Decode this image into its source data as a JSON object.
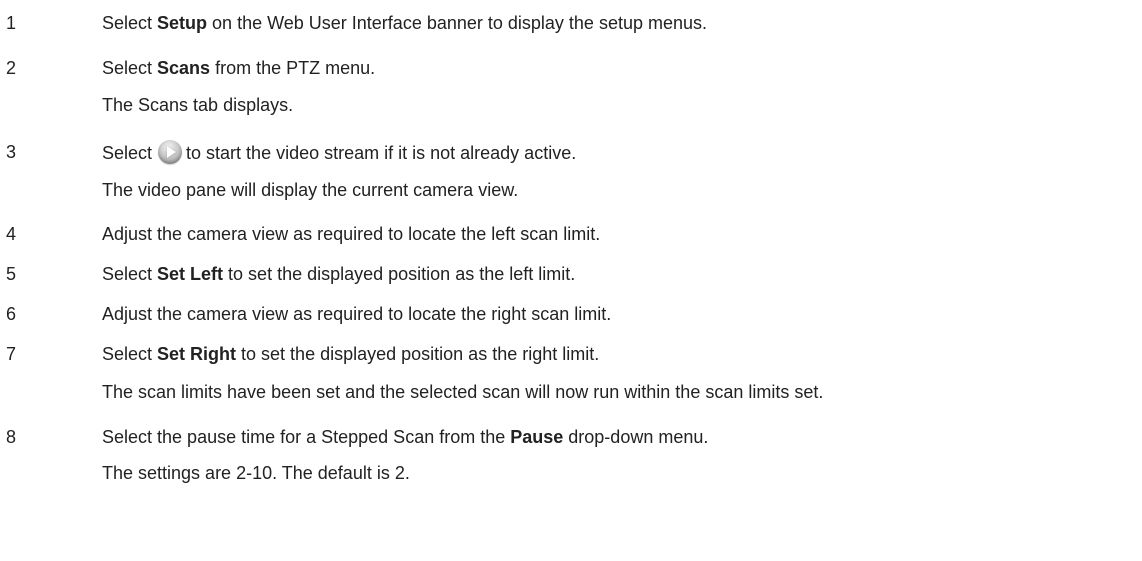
{
  "steps": [
    {
      "num": "1",
      "pre": "Select ",
      "bold": "Setup",
      "post": " on the Web User Interface banner to display the setup menus."
    },
    {
      "num": "2",
      "pre": "Select ",
      "bold": "Scans",
      "post": " from the PTZ menu."
    },
    {
      "note": "The Scans tab displays."
    },
    {
      "num": "3",
      "pre": "Select",
      "icon": "play-icon",
      "post": "to start the video stream if it is not already active."
    },
    {
      "note": "The video pane will display the current camera view."
    },
    {
      "num": "4",
      "text": "Adjust the camera view as required to locate the left scan limit."
    },
    {
      "num": "5",
      "pre": "Select ",
      "bold": "Set Left",
      "post": " to set the displayed position as the left limit."
    },
    {
      "num": "6",
      "text": "Adjust the camera view as required to locate the right scan limit."
    },
    {
      "num": "7",
      "pre": "Select ",
      "bold": "Set Right",
      "post": " to set the displayed position as the right limit."
    },
    {
      "note": "The scan limits have been set and the selected scan will now run within the scan limits set."
    },
    {
      "num": "8",
      "pre": "Select the pause time for a Stepped Scan from the ",
      "bold": "Pause",
      "post": " drop-down menu."
    },
    {
      "note": "The settings are 2-10. The default is 2."
    }
  ]
}
